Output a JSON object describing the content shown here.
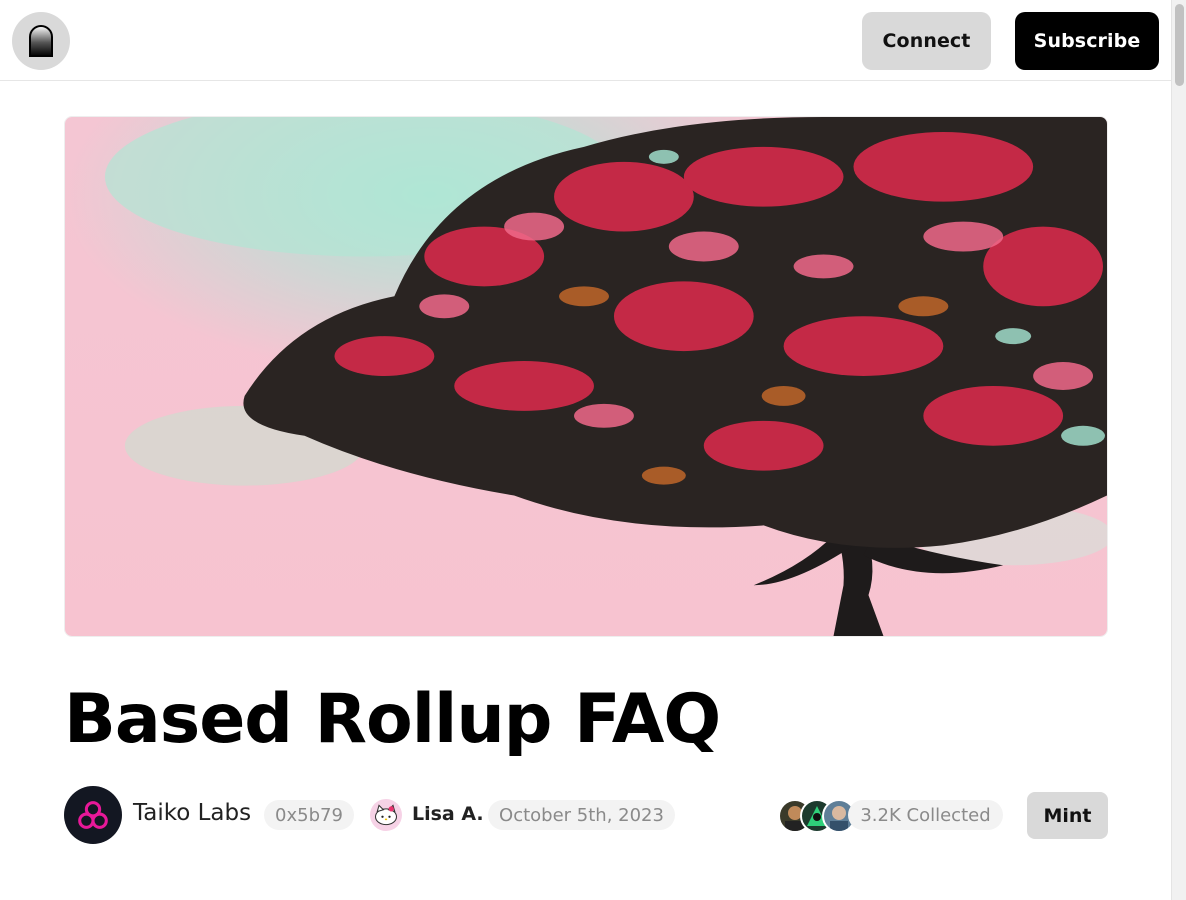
{
  "header": {
    "connect_label": "Connect",
    "subscribe_label": "Subscribe",
    "logo_icon": "mirror-logo-icon"
  },
  "article": {
    "title": "Based Rollup FAQ",
    "cover_image": "painting-of-tree-with-red-blossoms"
  },
  "meta": {
    "publication_name": "Taiko Labs",
    "publication_address": "0x5b79",
    "author_name": "Lisa A.",
    "date": "October 5th, 2023",
    "collected_text": "3.2K Collected",
    "mint_label": "Mint"
  },
  "colors": {
    "primary_button": "#000000",
    "secondary_button": "#d9d9d9",
    "taiko_pink": "#e81899",
    "pill_bg": "#f3f3f3"
  }
}
